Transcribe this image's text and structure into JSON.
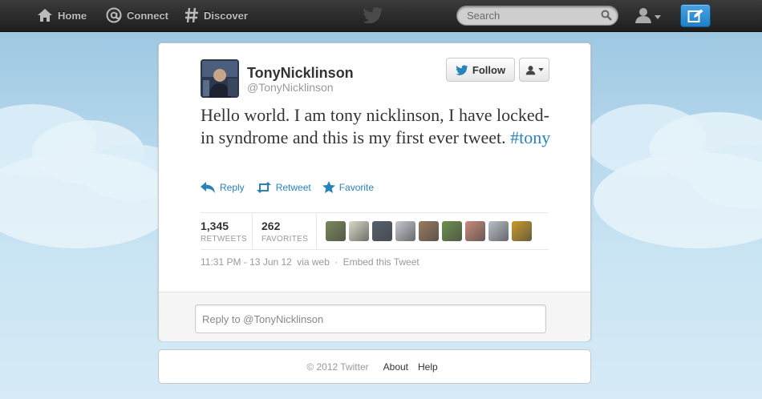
{
  "topbar": {
    "nav": [
      {
        "label": "Home",
        "icon": "home-icon"
      },
      {
        "label": "Connect",
        "icon": "at-icon"
      },
      {
        "label": "Discover",
        "icon": "hash-icon"
      }
    ],
    "search_placeholder": "Search"
  },
  "tweet": {
    "fullname": "TonyNicklinson",
    "screen_name": "@TonyNicklinson",
    "follow_label": "Follow",
    "text": "Hello world. I am tony nicklinson, I have locked-in syndrome and this is my first ever tweet. ",
    "hashtag": "#tony",
    "actions": {
      "reply": "Reply",
      "retweet": "Retweet",
      "favorite": "Favorite"
    },
    "stats": {
      "retweets_count": "1,345",
      "retweets_label": "RETWEETS",
      "favorites_count": "262",
      "favorites_label": "FAVORITES"
    },
    "favoriter_avatar_colors": [
      "#7a8a5a",
      "#d9d9c8",
      "#55606e",
      "#c4c9cf",
      "#9a7a5e",
      "#6e8f4e",
      "#c98a7a",
      "#b8c0c8",
      "#c99a2a"
    ],
    "timestamp": "11:31 PM - 13 Jun 12",
    "via": "via web",
    "embed": "Embed this Tweet",
    "reply_placeholder": "Reply to @TonyNicklinson"
  },
  "footer": {
    "copyright": "© 2012 Twitter",
    "links": [
      "About",
      "Help"
    ]
  },
  "colors": {
    "link": "#2a83b8",
    "topbar": "#2a2a2a",
    "compose": "#2d8ad0"
  }
}
